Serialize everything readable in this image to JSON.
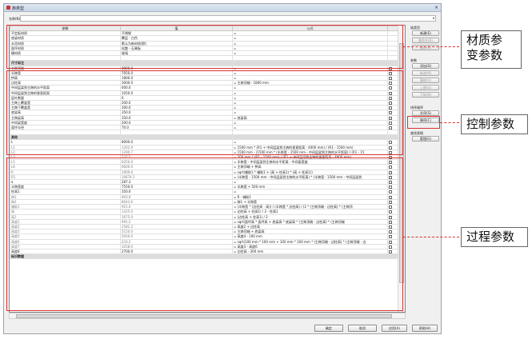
{
  "window": {
    "title": "族类型",
    "close_glyph": "×"
  },
  "name_field": {
    "label": "名称(N):",
    "value": ""
  },
  "table": {
    "headers": [
      "参数",
      "值",
      "公式",
      ""
    ],
    "rows": [
      {
        "type": "data",
        "cells": [
          "不定板材质",
          "不锈钢",
          "=",
          ""
        ],
        "check": false
      },
      {
        "type": "data",
        "cells": [
          "底梁材质",
          "覆层 - 白色",
          "=",
          ""
        ],
        "check": false
      },
      {
        "type": "data",
        "cells": [
          "水泥材质",
          "默认为新材质(默)",
          "=",
          ""
        ],
        "check": false
      },
      {
        "type": "data",
        "cells": [
          "面坪材质",
          "松散 - 石膏板",
          "=",
          ""
        ],
        "check": false
      },
      {
        "type": "data",
        "cells": [
          "栅材质",
          "玻璃",
          "=",
          ""
        ],
        "check": false
      },
      {
        "type": "blank",
        "cells": [
          "",
          "",
          "",
          ""
        ],
        "check": false
      },
      {
        "type": "group",
        "cells": [
          "尺寸标注",
          "",
          "",
          ""
        ],
        "check": false
      },
      {
        "type": "data",
        "cells": [
          "主跨顶端",
          "4800.0",
          "=",
          ""
        ],
        "check": true
      },
      {
        "type": "data",
        "cells": [
          "半跨宽",
          "7050.0",
          "=",
          ""
        ],
        "check": true
      },
      {
        "type": "data",
        "cells": [
          "拱高",
          "1800.0",
          "=",
          ""
        ],
        "check": true
      },
      {
        "type": "data",
        "cells": [
          "边柱高",
          "3000.0",
          "= 主跨顶端 - 1800 mm",
          ""
        ],
        "check": true
      },
      {
        "type": "data",
        "cells": [
          "中间层梁到主跨的水平距离",
          "600.0",
          "=",
          ""
        ],
        "check": true
      },
      {
        "type": "data",
        "cells": [
          "中间层梁到主跨的垂直距离",
          "1050.0",
          "=",
          ""
        ],
        "check": true
      },
      {
        "type": "data",
        "cells": [
          "层叶数量",
          "6",
          "=",
          ""
        ],
        "check": true
      },
      {
        "type": "data",
        "cells": [
          "主跨上覆盖宽",
          "200.0",
          "=",
          ""
        ],
        "check": true
      },
      {
        "type": "data",
        "cells": [
          "主跨下覆盖宽",
          "300.0",
          "=",
          ""
        ],
        "check": true
      },
      {
        "type": "data",
        "cells": [
          "底梁高",
          "350.0",
          "=",
          ""
        ],
        "check": true
      },
      {
        "type": "data",
        "cells": [
          "主跨梁高",
          "350.0",
          "= 底梁高",
          ""
        ],
        "check": true
      },
      {
        "type": "data",
        "cells": [
          "中间梁宽度",
          "200.0",
          "=",
          ""
        ],
        "check": true
      },
      {
        "type": "data",
        "cells": [
          "面坪半径",
          "70.0",
          "=",
          ""
        ],
        "check": true
      },
      {
        "type": "blank",
        "cells": [
          "",
          "",
          "",
          ""
        ],
        "check": false
      },
      {
        "type": "group",
        "cells": [
          "其他",
          "",
          "",
          ""
        ],
        "check": false
      },
      {
        "type": "data",
        "cells": [
          "L",
          "8000.0",
          "=",
          ""
        ],
        "check": true
      },
      {
        "type": "data",
        "cells": [
          "L1",
          "1262.9",
          "= 1500 mm * (R1 + 中间层梁到主跨的垂直距离 - 4000 mm) / (R1 - 1500 mm)",
          ""
        ],
        "check": true,
        "gray": true
      },
      {
        "type": "data",
        "cells": [
          "L2",
          "1290.7",
          "= 1500 mm - (1500 mm * (半跨宽 - 1500 mm - 中间层梁到主跨的水平距离) / (R1 - 15",
          ""
        ],
        "check": true,
        "gray": true
      },
      {
        "type": "data",
        "cells": [
          "L3",
          "237.5",
          "= 200 mm * (R1 - 1500 mm) / (R1 + 中间层梁到主跨的垂直距离 - 4000 mm)",
          ""
        ],
        "check": true,
        "gray": true
      },
      {
        "type": "data",
        "cells": [
          "L5",
          "6250.0",
          "= 半跨宽 - 中间层梁到主跨的水平距离 - 中间梁宽度",
          ""
        ],
        "check": true,
        "gray": true
      },
      {
        "type": "data",
        "cells": [
          "L6",
          "6600.0",
          "= 主跨顶端 + 拱高",
          ""
        ],
        "check": true,
        "gray": true
      },
      {
        "type": "data",
        "cells": [
          "R",
          "1909.6",
          "= sqrt(辅助1 * 辅助1 + (高 + 柱高1) * (高 + 柱高1))",
          ""
        ],
        "check": true,
        "gray": true
      },
      {
        "type": "data",
        "cells": [
          "R1",
          "10674.1",
          "= (半跨宽 - 1500 mm - 中间层梁到主跨的水平距离) * (半跨宽 - 1500 mm - 中间层梁到",
          ""
        ],
        "check": true,
        "gray": true
      },
      {
        "type": "data",
        "cells": [
          "a",
          "287.3",
          "=",
          ""
        ],
        "check": true
      },
      {
        "type": "data",
        "cells": [
          "半跨宽度",
          "7550.0",
          "= 半跨宽 + 500 mm",
          ""
        ],
        "check": true
      },
      {
        "type": "data",
        "cells": [
          "柱高1",
          "350.0",
          "=",
          ""
        ],
        "check": true
      },
      {
        "type": "data",
        "cells": [
          "跨1",
          "993.6",
          "= R - 辅助1",
          ""
        ],
        "check": true,
        "gray": true
      },
      {
        "type": "data",
        "cells": [
          "跨2",
          "8043.6",
          "= 跨1 + 半跨宽",
          ""
        ],
        "check": true,
        "gray": true
      },
      {
        "type": "data",
        "cells": [
          "辅助1",
          "915.0",
          "= (半跨宽 * (边柱高 - 高)) / (半跨宽 * 边柱高) / (2 * (主跨顶端 - 边柱高) * (主跨顶",
          ""
        ],
        "check": true,
        "gray": true
      },
      {
        "type": "data",
        "cells": [
          "高",
          "1325.0",
          "= 边柱高 + 柱高1) / 2 - 柱高1",
          ""
        ],
        "check": true,
        "gray": true
      },
      {
        "type": "data",
        "cells": [
          "高1",
          "1675.0",
          "= (边柱高 + 柱高1) / 2",
          ""
        ],
        "check": true,
        "gray": true
      },
      {
        "type": "data",
        "cells": [
          "高度1",
          "991.2",
          "= sqrt(面坪高 * 面坪高 + 底梁高 * 底梁高 * (主跨顶端 - 边柱高) * (主跨顶端",
          ""
        ],
        "check": true,
        "gray": true
      },
      {
        "type": "data",
        "cells": [
          "高度2",
          "1581.2",
          "= 高度2 + 边柱高",
          ""
        ],
        "check": true,
        "gray": true
      },
      {
        "type": "data",
        "cells": [
          "高度3",
          "5150.0",
          "= 主跨顶端 + 底梁高",
          ""
        ],
        "check": true,
        "gray": true
      },
      {
        "type": "data",
        "cells": [
          "高度5",
          "5050.0",
          "= 高度4 - 100 mm",
          ""
        ],
        "check": true,
        "gray": true
      },
      {
        "type": "data",
        "cells": [
          "高度6",
          "233.2",
          "= sqrt(100 mm * 100 mm + 100 mm * 100 mm * (主跨顶端 - 边柱高) * (主跨顶端 - 边",
          ""
        ],
        "check": true,
        "gray": true
      },
      {
        "type": "data",
        "cells": [
          "高度7",
          "3258.0",
          "= 高度3 - 高度6",
          ""
        ],
        "check": true,
        "gray": true
      },
      {
        "type": "data",
        "cells": [
          "高度8",
          "2700.0",
          "= 边柱高 - 300 mm",
          ""
        ],
        "check": true
      },
      {
        "type": "group",
        "cells": [
          "标识数据",
          "",
          "",
          ""
        ],
        "check": false
      }
    ]
  },
  "sidebar": {
    "family_types_label": "族类型",
    "new_btn": "新建(E)",
    "rename_btn": "重命名(R)",
    "delete_btn": "删除(E)",
    "params_label": "参数",
    "add_btn": "添加(D)",
    "modify_btn": "修改(M)",
    "remove_btn": "删除(V)",
    "up_btn": "上移(U)",
    "down_btn": "下移(W)",
    "sort_label": "排序顺序",
    "asc_btn": "升序(S)",
    "desc_btn": "降序(C)",
    "lookup_label": "查找表格",
    "manage_btn": "管理(G)"
  },
  "footer": {
    "ok": "确定",
    "cancel": "取消",
    "apply": "应用(A)",
    "help": "帮助(H)"
  },
  "annotations": {
    "material": "材质参\n变参数",
    "control": "控制参数",
    "process": "过程参数",
    "highlight_color": "#d9332f"
  }
}
